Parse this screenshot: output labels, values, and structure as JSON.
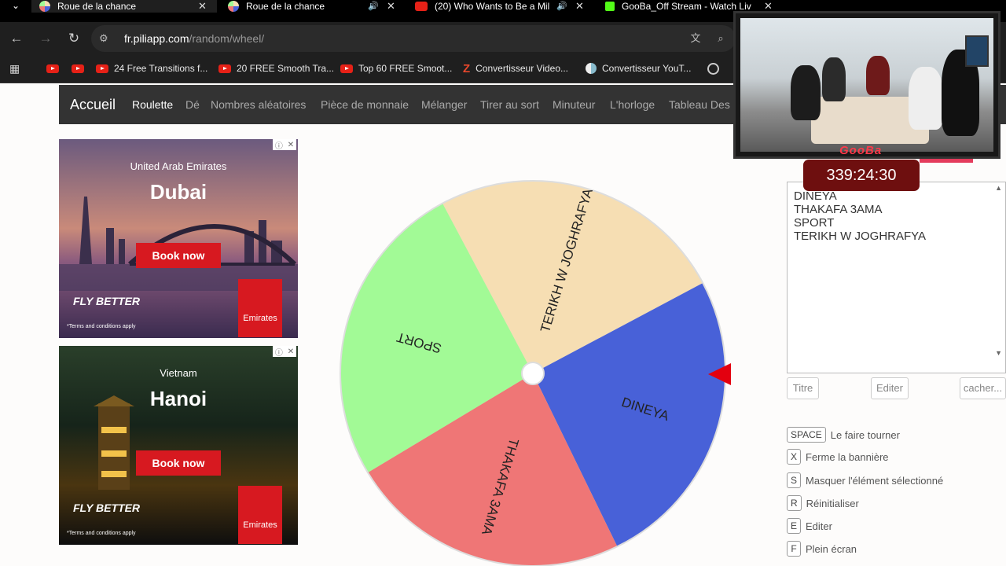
{
  "browser": {
    "tabs": [
      {
        "title": "Roue de la chance",
        "favicon_color": "#c8a0e8"
      },
      {
        "title": "Roue de la chance",
        "favicon_color": "#c8a0e8"
      },
      {
        "title": "(20) Who Wants to Be a Mil",
        "favicon_color": "#e62117"
      },
      {
        "title": "GooBa_Off Stream - Watch Liv",
        "favicon_color": "#53fc18"
      }
    ],
    "url_host": "fr.piliapp.com",
    "url_path": "/random/wheel/",
    "bookmarks": [
      {
        "label": ""
      },
      {
        "label": ""
      },
      {
        "label": "24 Free Transitions f..."
      },
      {
        "label": "20 FREE Smooth Tra..."
      },
      {
        "label": "Top 60 FREE Smoot..."
      },
      {
        "label": "Convertisseur Video..."
      },
      {
        "label": "Convertisseur YouT..."
      }
    ]
  },
  "site_nav": {
    "home": "Accueil",
    "items": [
      "Roulette",
      "Dé",
      "Nombres aléatoires",
      "Pièce de monnaie",
      "Mélanger",
      "Tirer au sort",
      "Minuteur",
      "L'horloge",
      "Tableau Des"
    ]
  },
  "ads": [
    {
      "country": "United Arab Emirates",
      "city": "Dubai",
      "cta": "Book now",
      "tagline": "FLY BETTER",
      "terms": "*Terms and conditions apply",
      "brand": "Emirates"
    },
    {
      "country": "Vietnam",
      "city": "Hanoi",
      "cta": "Book now",
      "tagline": "FLY BETTER",
      "terms": "*Terms and conditions apply",
      "brand": "Emirates"
    }
  ],
  "wheel": {
    "segments": [
      {
        "label": "TERIKH W JOGHRAFYA",
        "color": "#f6deb3"
      },
      {
        "label": "DINEYA",
        "color": "#4861d8"
      },
      {
        "label": "THAKAFA 3AMA",
        "color": "#ef7676"
      },
      {
        "label": "SPORT",
        "color": "#a2fa96"
      }
    ],
    "pointer_color": "#e3000f"
  },
  "panel": {
    "lines": [
      "DINEYA",
      "THAKAFA 3AMA",
      "SPORT",
      "TERIKH W JOGHRAFYA"
    ],
    "buttons": {
      "title": "Titre",
      "edit": "Editer",
      "hide": "cacher..."
    },
    "shortcuts": [
      {
        "key": "SPACE",
        "label": "Le faire tourner"
      },
      {
        "key": "X",
        "label": "Ferme la bannière"
      },
      {
        "key": "S",
        "label": "Masquer l'élément sélectionné"
      },
      {
        "key": "R",
        "label": "Réinitialiser"
      },
      {
        "key": "E",
        "label": "Editer"
      },
      {
        "key": "F",
        "label": "Plein écran"
      }
    ]
  },
  "stream": {
    "logo": "GooBa",
    "timer": "339:24:30"
  }
}
